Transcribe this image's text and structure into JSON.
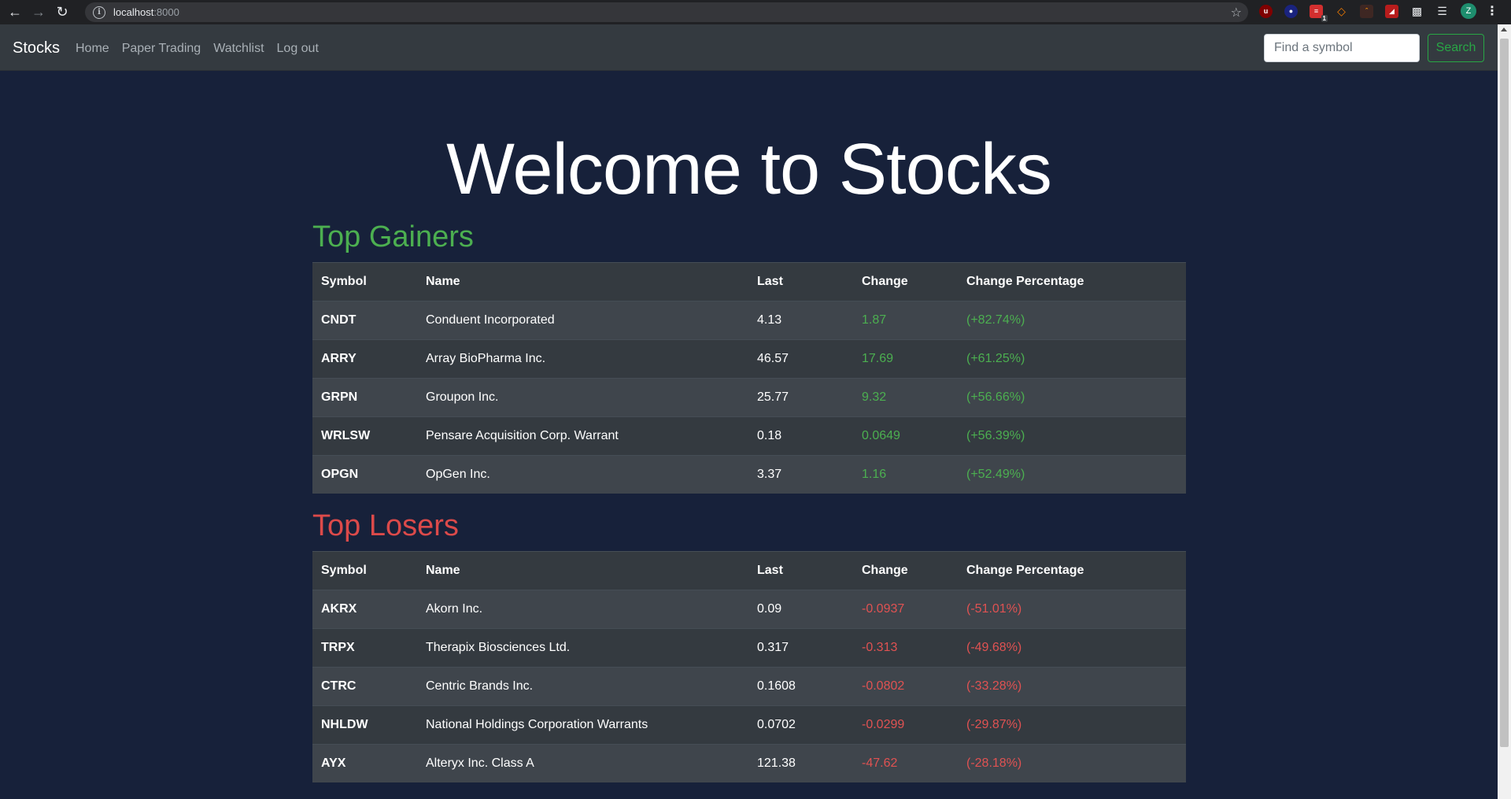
{
  "browser": {
    "url_host": "localhost",
    "url_port": ":8000",
    "extension_badge": "1",
    "profile_initial": "Z"
  },
  "navbar": {
    "brand": "Stocks",
    "links": [
      "Home",
      "Paper Trading",
      "Watchlist",
      "Log out"
    ],
    "search_placeholder": "Find a symbol",
    "search_button": "Search"
  },
  "hero": {
    "title": "Welcome to Stocks"
  },
  "colors": {
    "gain": "#4caf50",
    "loss": "#e05252",
    "background": "#17213a",
    "table": "#343a40"
  },
  "gainers": {
    "title": "Top Gainers",
    "headers": [
      "Symbol",
      "Name",
      "Last",
      "Change",
      "Change Percentage"
    ],
    "rows": [
      {
        "symbol": "CNDT",
        "name": "Conduent Incorporated",
        "last": "4.13",
        "change": "1.87",
        "pct": "(+82.74%)"
      },
      {
        "symbol": "ARRY",
        "name": "Array BioPharma Inc.",
        "last": "46.57",
        "change": "17.69",
        "pct": "(+61.25%)"
      },
      {
        "symbol": "GRPN",
        "name": "Groupon Inc.",
        "last": "25.77",
        "change": "9.32",
        "pct": "(+56.66%)"
      },
      {
        "symbol": "WRLSW",
        "name": "Pensare Acquisition Corp. Warrant",
        "last": "0.18",
        "change": "0.0649",
        "pct": "(+56.39%)"
      },
      {
        "symbol": "OPGN",
        "name": "OpGen Inc.",
        "last": "3.37",
        "change": "1.16",
        "pct": "(+52.49%)"
      }
    ]
  },
  "losers": {
    "title": "Top Losers",
    "headers": [
      "Symbol",
      "Name",
      "Last",
      "Change",
      "Change Percentage"
    ],
    "rows": [
      {
        "symbol": "AKRX",
        "name": "Akorn Inc.",
        "last": "0.09",
        "change": "-0.0937",
        "pct": "(-51.01%)"
      },
      {
        "symbol": "TRPX",
        "name": "Therapix Biosciences Ltd.",
        "last": "0.317",
        "change": "-0.313",
        "pct": "(-49.68%)"
      },
      {
        "symbol": "CTRC",
        "name": "Centric Brands Inc.",
        "last": "0.1608",
        "change": "-0.0802",
        "pct": "(-33.28%)"
      },
      {
        "symbol": "NHLDW",
        "name": "National Holdings Corporation Warrants",
        "last": "0.0702",
        "change": "-0.0299",
        "pct": "(-29.87%)"
      },
      {
        "symbol": "AYX",
        "name": "Alteryx Inc. Class A",
        "last": "121.38",
        "change": "-47.62",
        "pct": "(-28.18%)"
      }
    ]
  }
}
